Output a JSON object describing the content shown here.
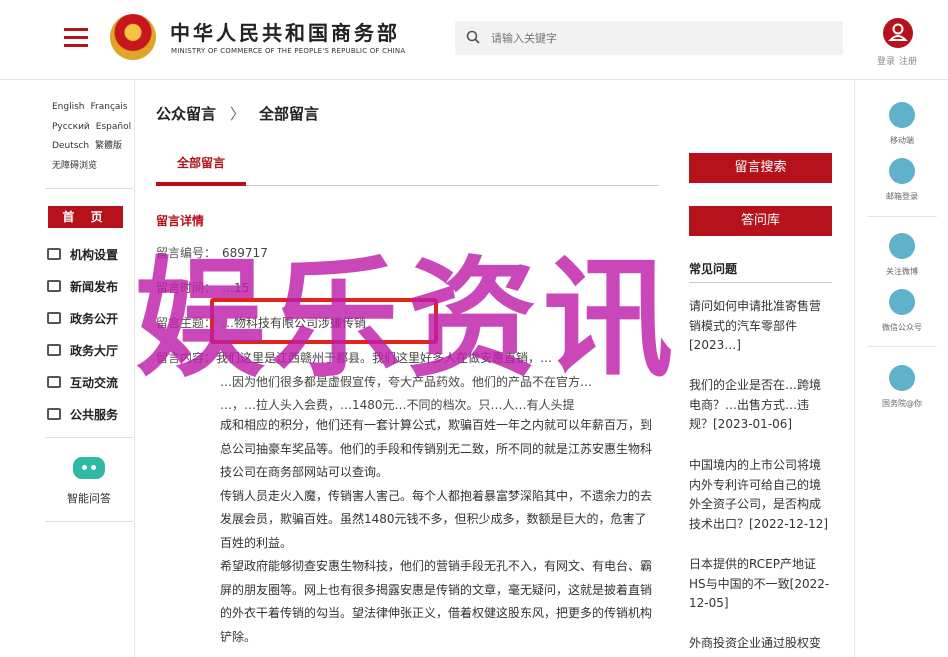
{
  "header": {
    "logo_cn": "中华人民共和国商务部",
    "logo_en": "MINISTRY OF COMMERCE OF THE PEOPLE'S REPUBLIC OF CHINA",
    "search_placeholder": "请输入关键字",
    "login": "登录",
    "register": "注册"
  },
  "languages": [
    "English",
    "Français",
    "Русский",
    "Español",
    "Deutsch",
    "繁體版",
    "无障碍浏览"
  ],
  "left_nav": {
    "home": "首 页",
    "items": [
      "机构设置",
      "新闻发布",
      "政务公开",
      "政务大厅",
      "互动交流",
      "公共服务"
    ],
    "ai_label": "智能问答"
  },
  "breadcrumb": {
    "root": "公众留言",
    "sep": "〉",
    "current": "全部留言"
  },
  "tabs": {
    "active": "全部留言"
  },
  "detail": {
    "section_title": "留言详情",
    "id_label": "留言编号：",
    "id_value": "689717",
    "time_label": "留言时间：",
    "time_value": "…15",
    "subject_label": "留言主题：",
    "subject_value": "…物科技有限公司涉嫌传销",
    "content_label": "留言内容：",
    "content_line1": "我们这里是江西赣州于都县。我们这里好多人在做安惠直销，…",
    "content_line2": "…因为他们很多都是虚假宣传，夸大产品药效。他们的产品不在官方…",
    "content_line3": "…，…拉人头入会费，…1480元…不同的档次。只…人…有人头提",
    "paragraphs": [
      "成和相应的积分，他们还有一套计算公式，欺骗百姓一年之内就可以年薪百万，到总公司抽豪车奖品等。他们的手段和传销别无二致，所不同的就是江苏安惠生物科技公司在商务部网站可以查询。",
      "传销人员走火入魔，传销害人害己。每个人都抱着暴富梦深陷其中，不遗余力的去发展会员，欺骗百姓。虽然1480元钱不多，但积少成多，数额是巨大的，危害了百姓的利益。",
      "希望政府能够彻查安惠生物科技，他们的营销手段无孔不入，有网文、有电台、霸屏的朋友圈等。网上也有很多揭露安惠是传销的文章，毫无疑问，这就是披着直销的外衣干着传销的勾当。望法律伸张正义，借着权健这股东风，把更多的传销机构铲除。"
    ]
  },
  "right_col": {
    "search_btn": "留言搜索",
    "faq_btn": "答问库",
    "faq_title": "常见问题",
    "faq_items": [
      "请问如何申请批准寄售营销模式的汽车零部件[2023…]",
      "我们的企业是否在…跨境电商？…出售方式…违规？[2023-01-06]",
      "中国境内的上市公司将境内外专利许可给自己的境外全资子公司，是否构成技术出口？[2022-12-12]",
      "日本提供的RCEP产地证HS与中国的不一致[2022-12-05]",
      "外商投资企业通过股权变"
    ]
  },
  "right_side": {
    "items": [
      "移动端",
      "邮箱登录",
      "关注微博",
      "微信公众号",
      "国务院@你"
    ]
  },
  "watermark": "娱乐资讯",
  "colors": {
    "brand_red": "#b5121b",
    "watermark": "#be1eaa",
    "accent_teal": "#5fb2c9"
  }
}
